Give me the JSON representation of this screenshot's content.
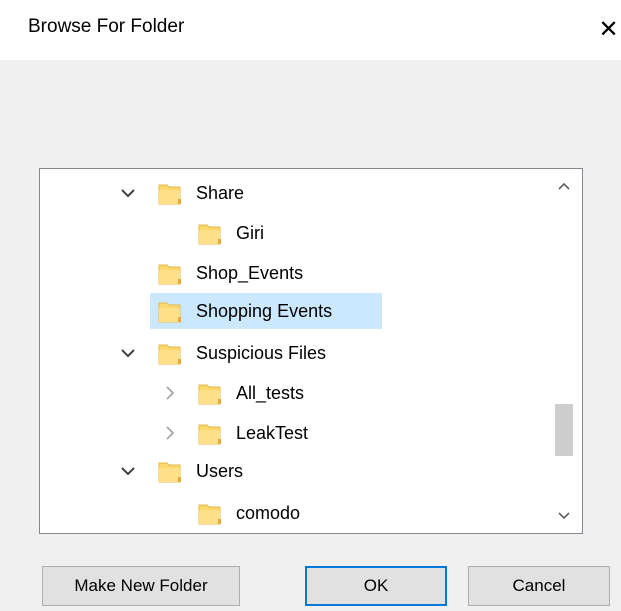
{
  "dialog": {
    "title": "Browse For Folder",
    "close_glyph": "✕"
  },
  "tree": {
    "rows": [
      {
        "label": "Share",
        "expander": "expanded",
        "icon": "folder-icon",
        "selected": false
      },
      {
        "label": "Giri",
        "expander": "none",
        "icon": "folder-icon",
        "selected": false
      },
      {
        "label": "Shop_Events",
        "expander": "none",
        "icon": "folder-icon",
        "selected": false
      },
      {
        "label": "Shopping Events",
        "expander": "none",
        "icon": "folder-icon",
        "selected": true
      },
      {
        "label": "Suspicious Files",
        "expander": "expanded",
        "icon": "folder-icon",
        "selected": false
      },
      {
        "label": "All_tests",
        "expander": "collapsed",
        "icon": "folder-icon",
        "selected": false
      },
      {
        "label": "LeakTest",
        "expander": "collapsed",
        "icon": "folder-icon",
        "selected": false
      },
      {
        "label": "Users",
        "expander": "expanded",
        "icon": "folder-icon",
        "selected": false
      },
      {
        "label": "comodo",
        "expander": "none",
        "icon": "folder-icon",
        "selected": false
      }
    ],
    "scroll_position_fraction": 0.7
  },
  "buttons": {
    "make_new_folder": "Make New Folder",
    "ok": "OK",
    "cancel": "Cancel"
  },
  "colors": {
    "selection": "#cce8ff",
    "folder_yellow": "#ffd86b",
    "default_button_border": "#0078d7"
  }
}
